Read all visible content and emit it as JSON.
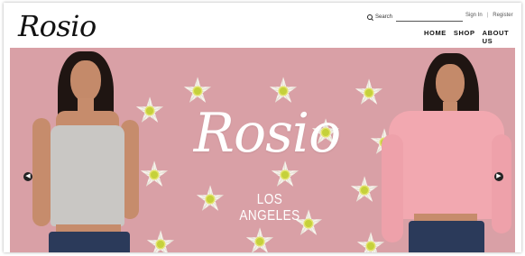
{
  "brand": {
    "logo_text": "Rosio"
  },
  "header": {
    "search_label": "Search",
    "search_placeholder": "",
    "sign_in": "Sign In",
    "separator": "|",
    "register": "Register",
    "nav": [
      "HOME",
      "SHOP",
      "ABOUT US"
    ]
  },
  "hero": {
    "title": "Rosio",
    "subtitle": "LOS ANGELES",
    "prev_icon": "arrow-left-icon",
    "next_icon": "arrow-right-icon",
    "background_color": "#d9a0a6"
  }
}
